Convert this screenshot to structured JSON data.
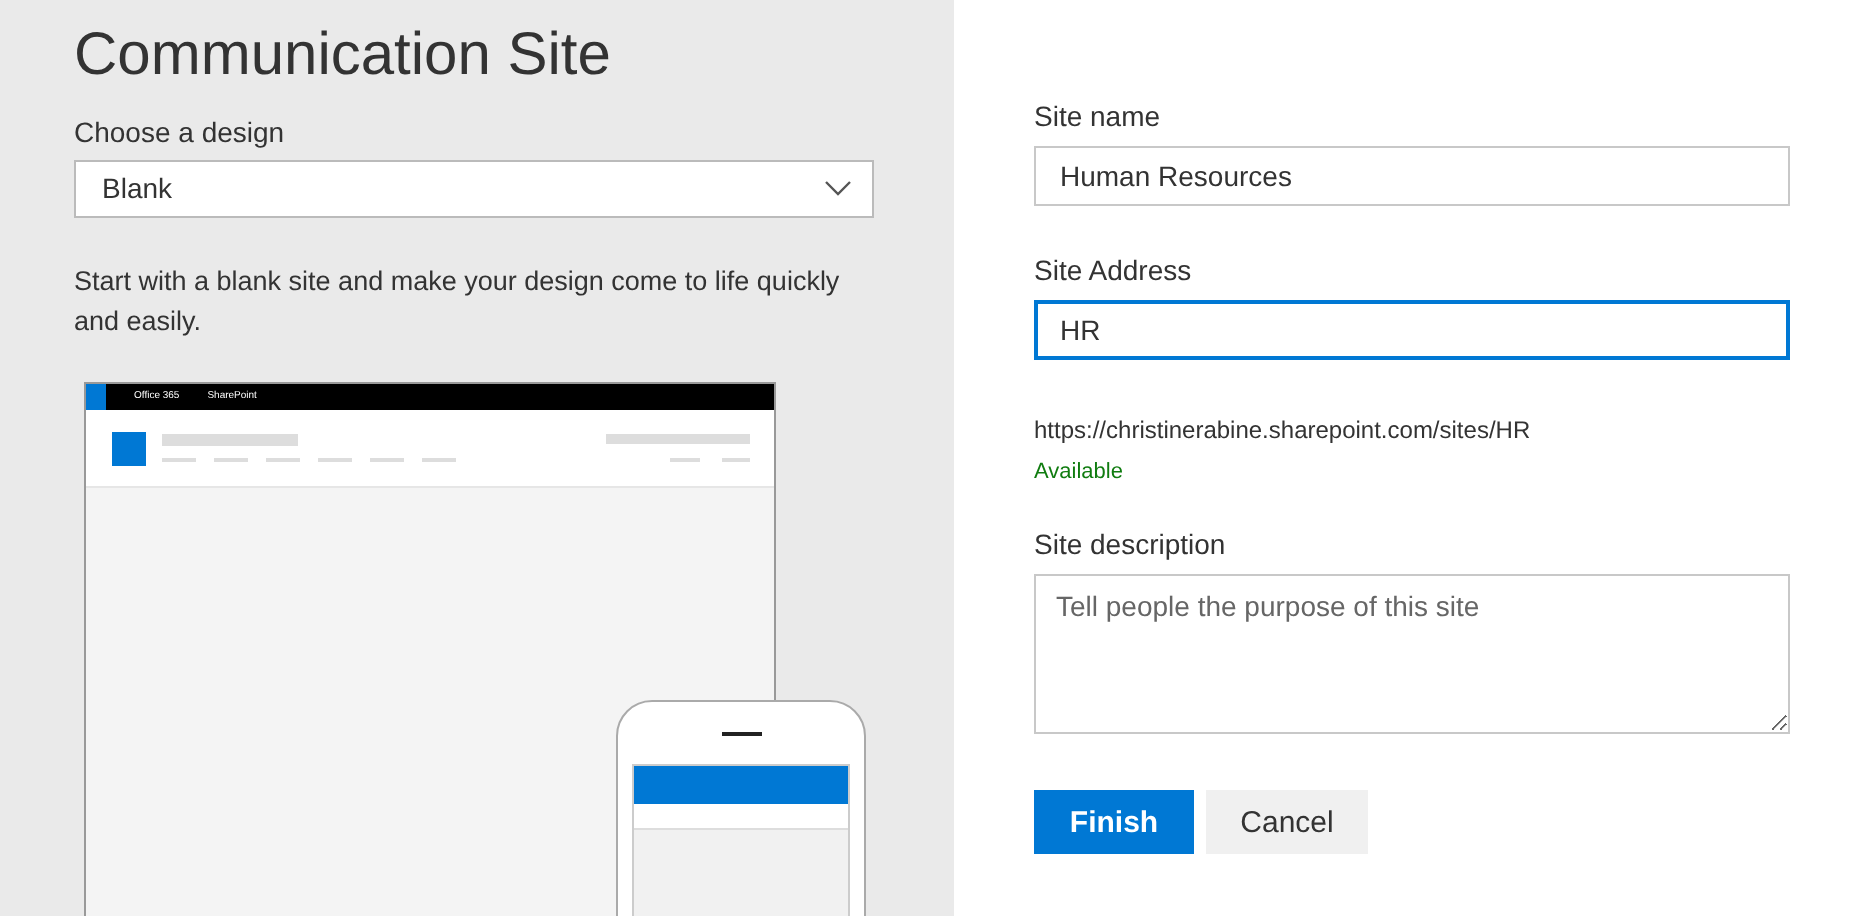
{
  "title": "Communication Site",
  "design": {
    "label": "Choose a design",
    "value": "Blank",
    "description": "Start with a blank site and make your design come to life quickly and easily."
  },
  "preview": {
    "suite_bar": [
      "Office 365",
      "SharePoint"
    ]
  },
  "form": {
    "fields": [
      {
        "kind": "input",
        "label": "Site name",
        "value": "Human Resources",
        "focused": false
      },
      {
        "kind": "input",
        "label": "Site Address",
        "value": "HR",
        "focused": true
      },
      {
        "kind": "url",
        "text": "https://christinerabine.sharepoint.com/sites/HR",
        "status": "Available"
      },
      {
        "kind": "textarea",
        "label": "Site description",
        "placeholder": "Tell people the purpose of this site",
        "focused": false
      }
    ]
  },
  "buttons": [
    {
      "label": "Finish",
      "kind": "primary"
    },
    {
      "label": "Cancel",
      "kind": "secondary"
    }
  ]
}
